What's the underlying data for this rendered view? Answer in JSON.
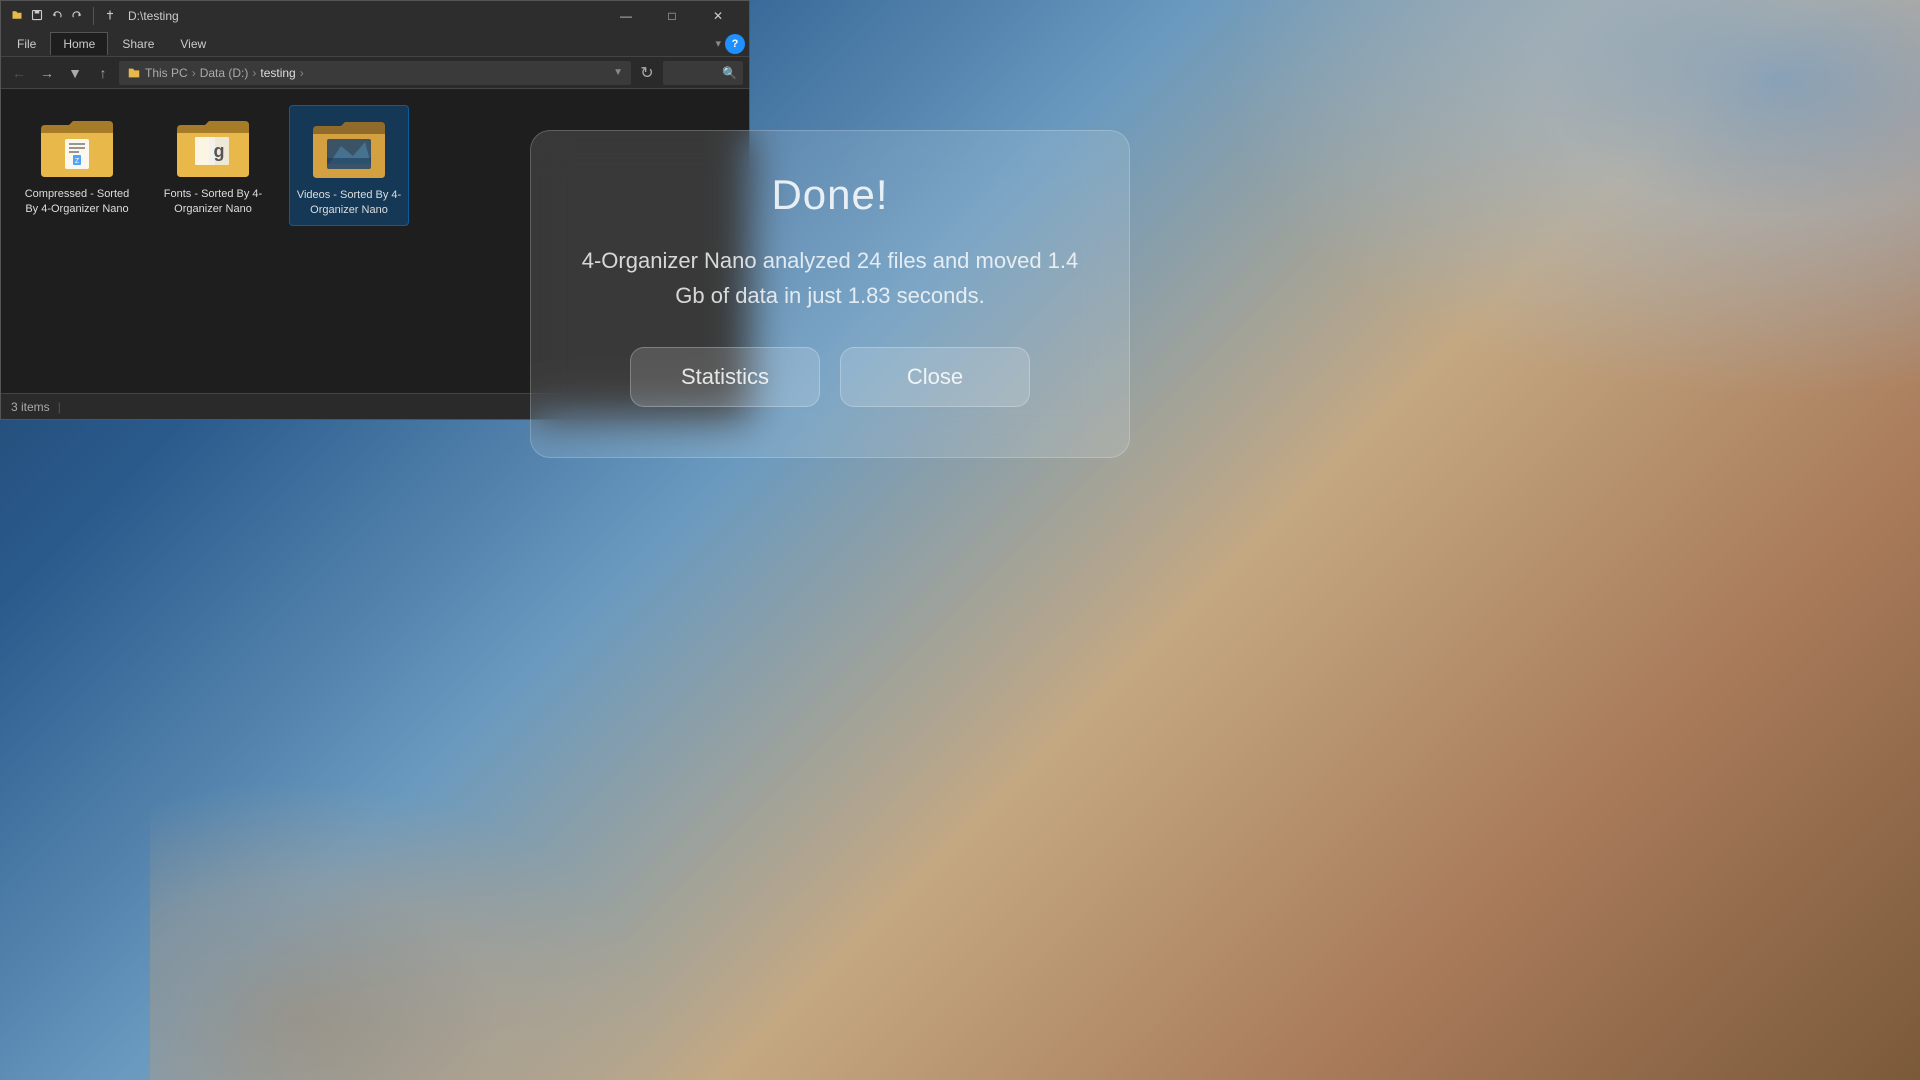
{
  "desktop": {
    "background_desc": "Windows 11 style blue-orange gradient wallpaper"
  },
  "explorer": {
    "title": "D:\\testing",
    "titlebar": {
      "icons": [
        "file-icon",
        "save-icon",
        "undo-icon",
        "redo-icon",
        "pin-icon"
      ],
      "path_label": "D:\\testing",
      "minimize_label": "—",
      "maximize_label": "□",
      "close_label": "✕"
    },
    "ribbon": {
      "tabs": [
        "File",
        "Home",
        "Share",
        "View"
      ],
      "active_tab": "Home",
      "dropdown_arrow": "▾",
      "help_label": "?"
    },
    "addressbar": {
      "back_label": "←",
      "forward_label": "→",
      "dropdown_label": "▾",
      "up_label": "↑",
      "path_parts": [
        "This PC",
        "Data (D:)",
        "testing"
      ],
      "refresh_label": "⟳",
      "search_placeholder": "🔍"
    },
    "folders": [
      {
        "name": "Compressed - Sorted By 4-Organizer Nano",
        "type": "compressed",
        "selected": false
      },
      {
        "name": "Fonts - Sorted By 4-Organizer Nano",
        "type": "fonts",
        "selected": false
      },
      {
        "name": "Videos - Sorted By 4-Organizer Nano",
        "type": "videos",
        "selected": true
      }
    ],
    "statusbar": {
      "items_count": "3 items",
      "view_icons": [
        "≡",
        "⊞"
      ]
    }
  },
  "dialog": {
    "title": "Done!",
    "message": "4-Organizer Nano analyzed 24 files and moved 1.4 Gb of data in just 1.83 seconds.",
    "buttons": {
      "statistics_label": "Statistics",
      "close_label": "Close"
    }
  }
}
